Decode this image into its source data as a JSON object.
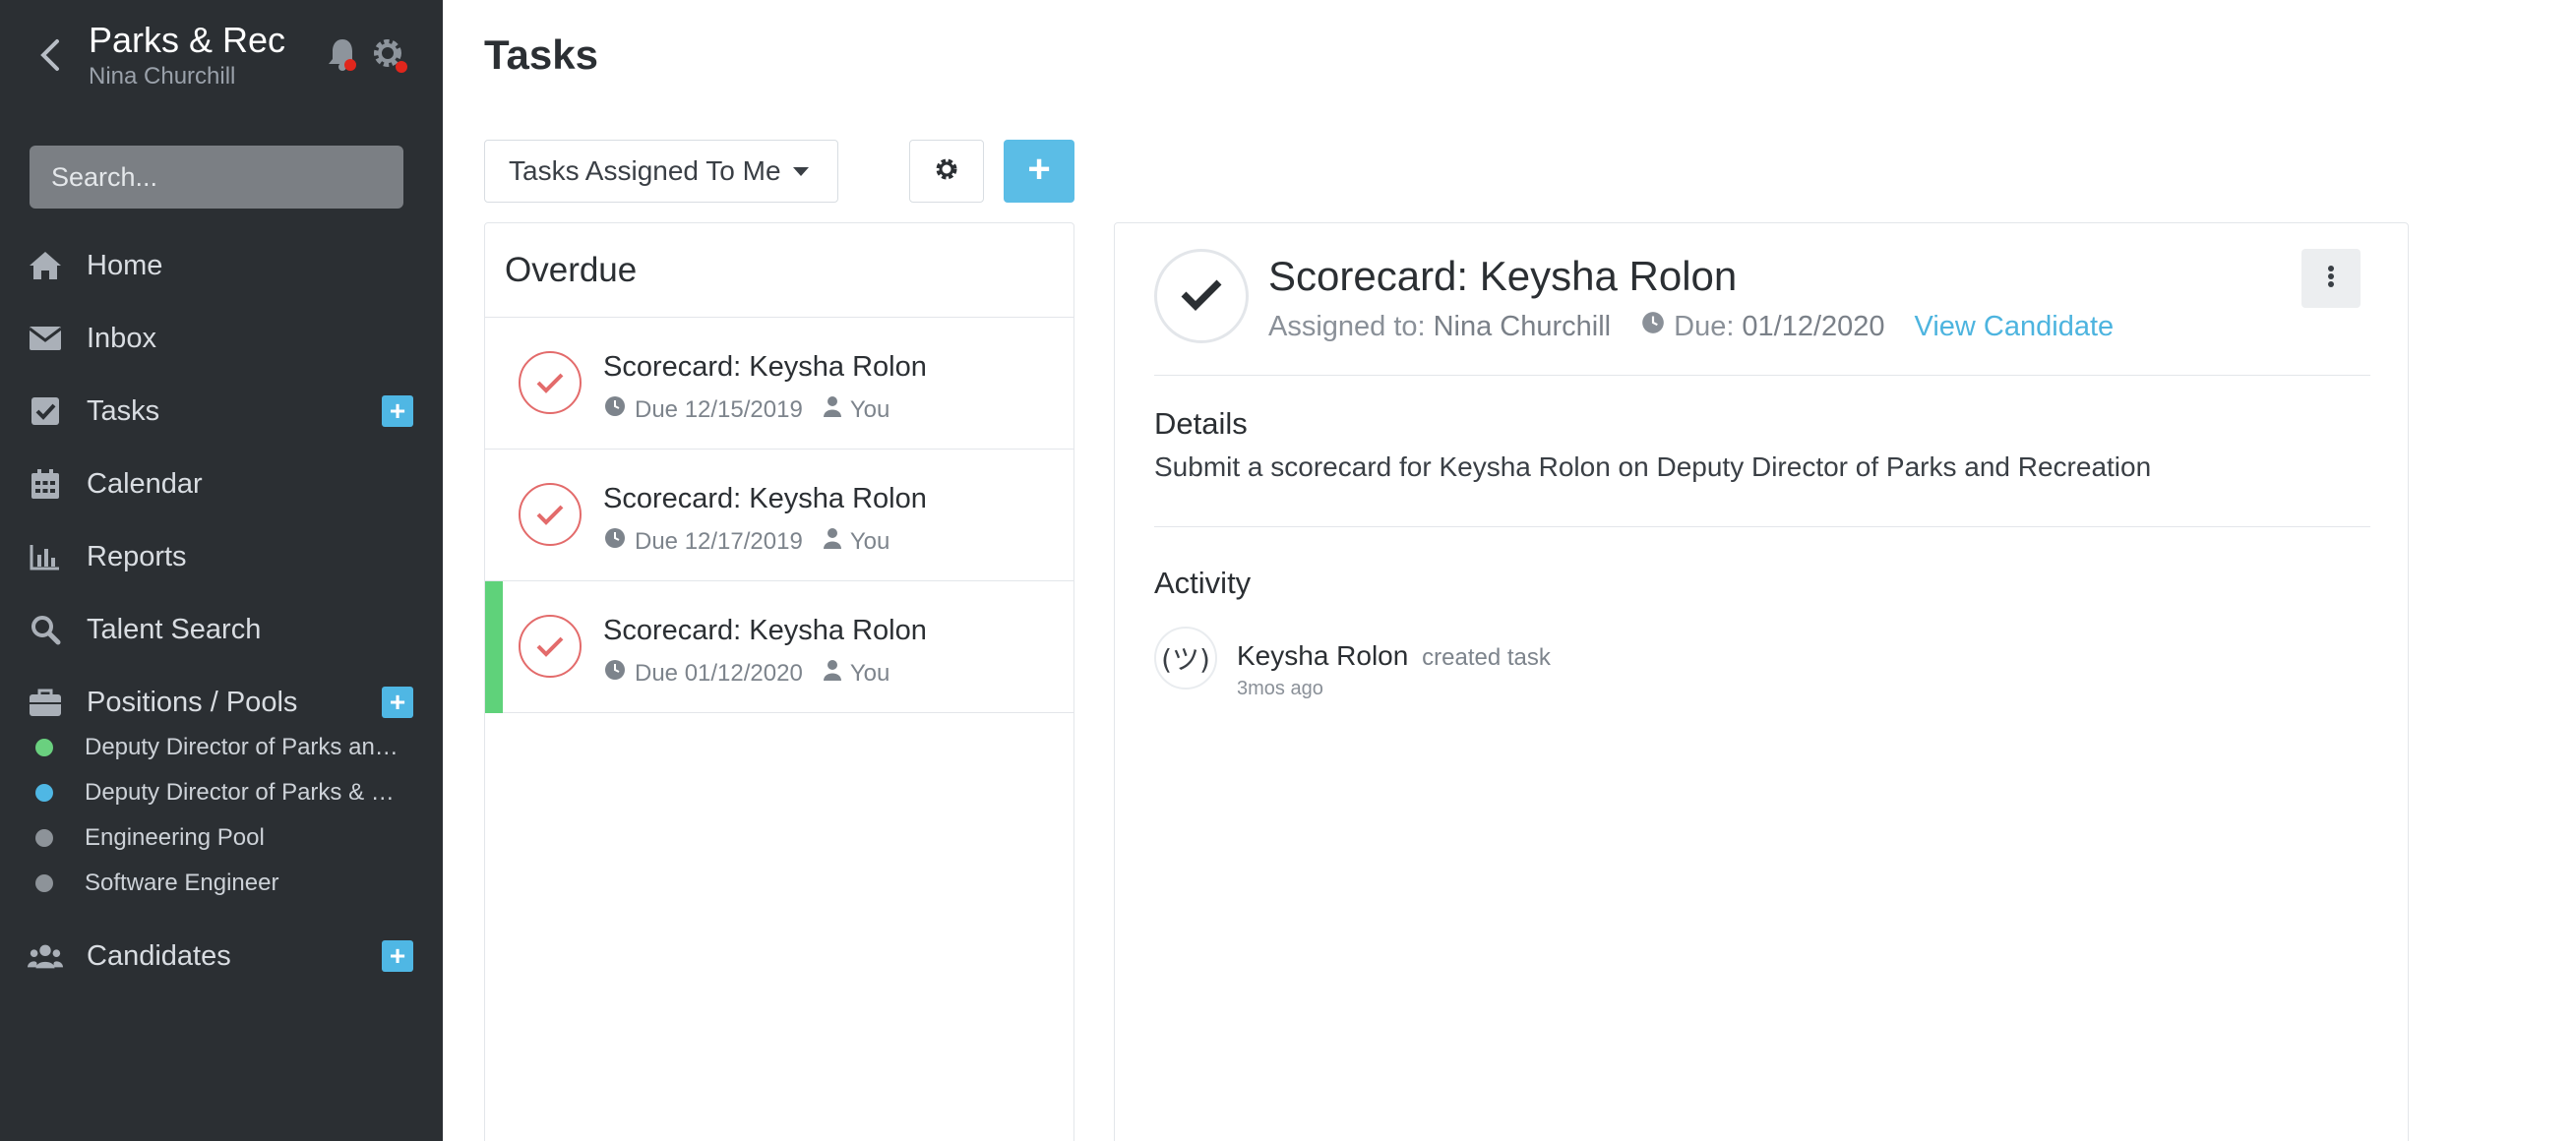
{
  "app": {
    "title": "Parks & Rec",
    "user": "Nina Churchill"
  },
  "search": {
    "placeholder": "Search..."
  },
  "nav": {
    "home": "Home",
    "inbox": "Inbox",
    "tasks": "Tasks",
    "calendar": "Calendar",
    "reports": "Reports",
    "talent_search": "Talent Search",
    "positions": "Positions / Pools",
    "candidates": "Candidates",
    "plus": "+"
  },
  "positions": [
    {
      "label": "Deputy Director of Parks and Recreation",
      "color": "#6ad07f"
    },
    {
      "label": "Deputy Director of Parks & Recreation",
      "color": "#4fb7e4"
    },
    {
      "label": "Engineering Pool",
      "color": "#8d9399"
    },
    {
      "label": "Software Engineer",
      "color": "#8d9399"
    }
  ],
  "page": {
    "title": "Tasks",
    "filter": "Tasks Assigned To Me",
    "add": "+"
  },
  "list": {
    "heading": "Overdue",
    "tasks": [
      {
        "title": "Scorecard: Keysha Rolon",
        "due": "Due 12/15/2019",
        "assignee": "You"
      },
      {
        "title": "Scorecard: Keysha Rolon",
        "due": "Due 12/17/2019",
        "assignee": "You"
      },
      {
        "title": "Scorecard: Keysha Rolon",
        "due": "Due 01/12/2020",
        "assignee": "You"
      }
    ]
  },
  "detail": {
    "title": "Scorecard: Keysha Rolon",
    "assigned_label": "Assigned to:",
    "assigned_value": "Nina Churchill",
    "due_label": "Due:",
    "due_value": "01/12/2020",
    "view_link": "View Candidate",
    "details_heading": "Details",
    "details_text": "Submit a scorecard for Keysha Rolon on Deputy Director of Parks and Recreation",
    "activity_heading": "Activity",
    "activity": {
      "avatar": "(ツ)",
      "name": "Keysha Rolon",
      "action": "created task",
      "time": "3mos ago"
    }
  },
  "icons": {
    "back": "chevron-left-icon",
    "bell": "bell-icon",
    "gear": "gear-icon",
    "home": "home-icon",
    "inbox": "envelope-icon",
    "tasks": "checkbox-icon",
    "calendar": "calendar-icon",
    "reports": "bar-chart-icon",
    "search": "search-icon",
    "positions": "briefcase-icon",
    "candidates": "users-icon",
    "clock": "clock-icon",
    "user": "user-icon",
    "check": "check-icon",
    "kebab": "kebab-icon"
  },
  "colors": {
    "sidebar_bg": "#2b2f33",
    "accent": "#5bbde6",
    "overdue": "#e36b6b",
    "active_bar": "#5fd27a",
    "notification": "#e0261c"
  }
}
